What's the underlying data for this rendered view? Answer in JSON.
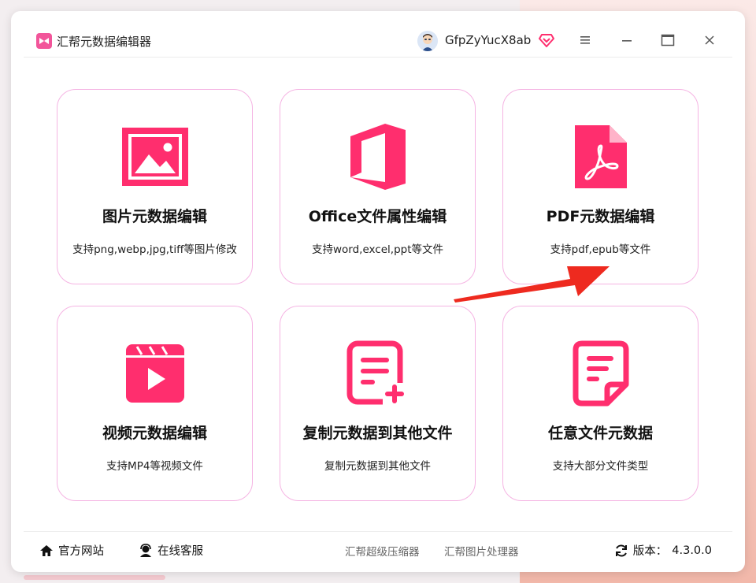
{
  "app": {
    "title": "汇帮元数据编辑器",
    "user_name": "GfpZyYucX8ab"
  },
  "colors": {
    "accent": "#ff2e6e",
    "card_border": "#f5b4e3",
    "arrow": "#ee2a1f"
  },
  "window_controls": [
    "menu-icon",
    "minimize-icon",
    "maximize-icon",
    "close-icon"
  ],
  "cards": [
    {
      "title": "图片元数据编辑",
      "desc": "支持png,webp,jpg,tiff等图片修改",
      "icon": "image-icon"
    },
    {
      "title": "Office文件属性编辑",
      "desc": "支持word,excel,ppt等文件",
      "icon": "office-icon"
    },
    {
      "title": "PDF元数据编辑",
      "desc": "支持pdf,epub等文件",
      "icon": "pdf-icon"
    },
    {
      "title": "视频元数据编辑",
      "desc": "支持MP4等视频文件",
      "icon": "video-icon"
    },
    {
      "title": "复制元数据到其他文件",
      "desc": "复制元数据到其他文件",
      "icon": "copy-doc-icon"
    },
    {
      "title": "任意文件元数据",
      "desc": "支持大部分文件类型",
      "icon": "file-icon"
    }
  ],
  "footer": {
    "official_site": "官方网站",
    "online_support": "在线客服",
    "compressor": "汇帮超级压缩器",
    "image_processor": "汇帮图片处理器",
    "version_label": "版本：",
    "version_value": "4.3.0.0"
  }
}
